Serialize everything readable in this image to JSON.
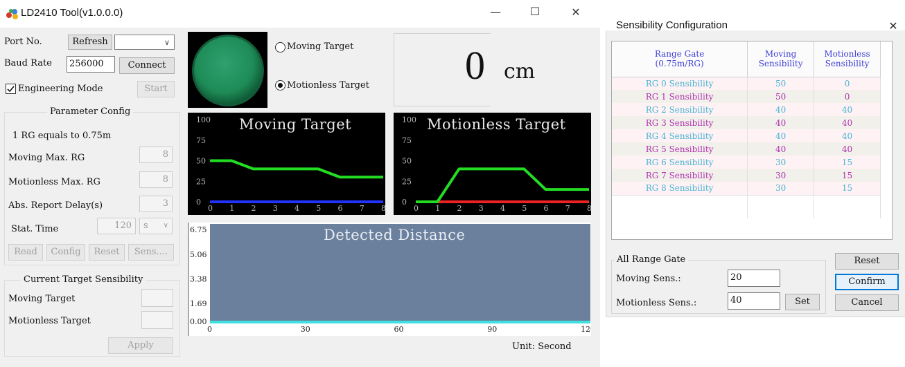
{
  "main": {
    "title": "LD2410 Tool(v1.0.0.0)",
    "window_buttons": {
      "minimize": "—",
      "maximize": "☐",
      "close": "✕"
    },
    "port_label": "Port No.",
    "refresh_label": "Refresh",
    "port_value": "",
    "baud_label": "Baud Rate",
    "baud_value": "256000",
    "connect_label": "Connect",
    "engineering_label": "Engineering Mode",
    "engineering_checked": true,
    "start_label": "Start",
    "param_title": "Parameter Config",
    "rg_info": "1 RG equals to 0.75m",
    "moving_max_label": "Moving Max. RG",
    "moving_max_value": "8",
    "motionless_max_label": "Motionless Max. RG",
    "motionless_max_value": "8",
    "delay_label": "Abs. Report Delay(s)",
    "delay_value": "3",
    "stat_label": "Stat. Time",
    "stat_value": "120",
    "stat_unit": "s",
    "read_label": "Read",
    "config_label": "Config",
    "reset_label": "Reset",
    "sens_label": "Sens....",
    "current_title": "Current Target Sensibility",
    "cur_moving_label": "Moving Target",
    "cur_motionless_label": "Motionless Target",
    "apply_label": "Apply",
    "radio_moving": "Moving Target",
    "radio_motionless": "Motionless Target",
    "radio_selected": "motionless",
    "distance_value": "0",
    "distance_unit": "cm",
    "unit_label": "Unit: Second"
  },
  "chart_data": [
    {
      "type": "line",
      "title": "Moving Target",
      "x": [
        0,
        1,
        2,
        3,
        4,
        5,
        6,
        7,
        8
      ],
      "series": [
        {
          "values": [
            50,
            50,
            40,
            40,
            40,
            40,
            30,
            30,
            30
          ],
          "color": "#22dd22"
        },
        {
          "values": [
            0,
            0,
            0,
            0,
            0,
            0,
            0,
            0,
            0
          ],
          "color": "#2233ff"
        }
      ],
      "ylim": [
        0,
        100
      ],
      "yticks": [
        0,
        25,
        50,
        75,
        100
      ],
      "xticks": [
        0,
        1,
        2,
        3,
        4,
        5,
        6,
        7,
        8
      ],
      "background": "#000000"
    },
    {
      "type": "line",
      "title": "Motionless Target",
      "x": [
        0,
        1,
        2,
        3,
        4,
        5,
        6,
        7,
        8
      ],
      "series": [
        {
          "values": [
            0,
            0,
            40,
            40,
            40,
            40,
            15,
            15,
            15
          ],
          "color": "#22dd22"
        },
        {
          "values": [
            0,
            0,
            0,
            0,
            0,
            0,
            0,
            0,
            0
          ],
          "color": "#ee2222"
        }
      ],
      "ylim": [
        0,
        100
      ],
      "yticks": [
        0,
        25,
        50,
        75,
        100
      ],
      "xticks": [
        0,
        1,
        2,
        3,
        4,
        5,
        6,
        7,
        8
      ],
      "background": "#000000"
    },
    {
      "type": "area",
      "title": "Detected Distance",
      "x": [
        0,
        120
      ],
      "series": [
        {
          "values": [
            0,
            0
          ],
          "color": "#40e0e0"
        }
      ],
      "ylim": [
        0,
        6.75
      ],
      "ytick_labels": [
        "0.00",
        "1.69",
        "3.38",
        "5.06",
        "6.75"
      ],
      "xticks": [
        0,
        30,
        60,
        90,
        120
      ],
      "xlabel": "Unit: Second",
      "background": "#6b809c"
    }
  ],
  "sens": {
    "title": "Sensibility Configuration",
    "close": "✕",
    "headers": {
      "gate": "Range Gate\n(0.75m/RG)",
      "moving": "Moving\nSensibility",
      "motionless": "Motionless\nSensibility"
    },
    "rows": [
      {
        "gate": "RG 0 Sensibility",
        "moving": "50",
        "motionless": "0",
        "color": "#44b4d4",
        "bg": "#fff2f4"
      },
      {
        "gate": "RG 1 Sensibility",
        "moving": "50",
        "motionless": "0",
        "color": "#b030b0",
        "bg": "#f2f0ea"
      },
      {
        "gate": "RG 2 Sensibility",
        "moving": "40",
        "motionless": "40",
        "color": "#44b4d4",
        "bg": "#fff2f4"
      },
      {
        "gate": "RG 3 Sensibility",
        "moving": "40",
        "motionless": "40",
        "color": "#b030b0",
        "bg": "#f2f0ea"
      },
      {
        "gate": "RG 4 Sensibility",
        "moving": "40",
        "motionless": "40",
        "color": "#44b4d4",
        "bg": "#fff2f4"
      },
      {
        "gate": "RG 5 Sensibility",
        "moving": "40",
        "motionless": "40",
        "color": "#b030b0",
        "bg": "#f2f0ea"
      },
      {
        "gate": "RG 6 Sensibility",
        "moving": "30",
        "motionless": "15",
        "color": "#44b4d4",
        "bg": "#fff2f4"
      },
      {
        "gate": "RG 7 Sensibility",
        "moving": "30",
        "motionless": "15",
        "color": "#b030b0",
        "bg": "#f2f0ea"
      },
      {
        "gate": "RG 8 Sensibility",
        "moving": "30",
        "motionless": "15",
        "color": "#44b4d4",
        "bg": "#fff2f4"
      }
    ],
    "all_gate_title": "All Range Gate",
    "moving_sens_label": "Moving Sens.:",
    "moving_sens_value": "20",
    "motionless_sens_label": "Motionless Sens.:",
    "motionless_sens_value": "40",
    "set_label": "Set",
    "reset_label": "Reset",
    "confirm_label": "Confirm",
    "cancel_label": "Cancel"
  }
}
